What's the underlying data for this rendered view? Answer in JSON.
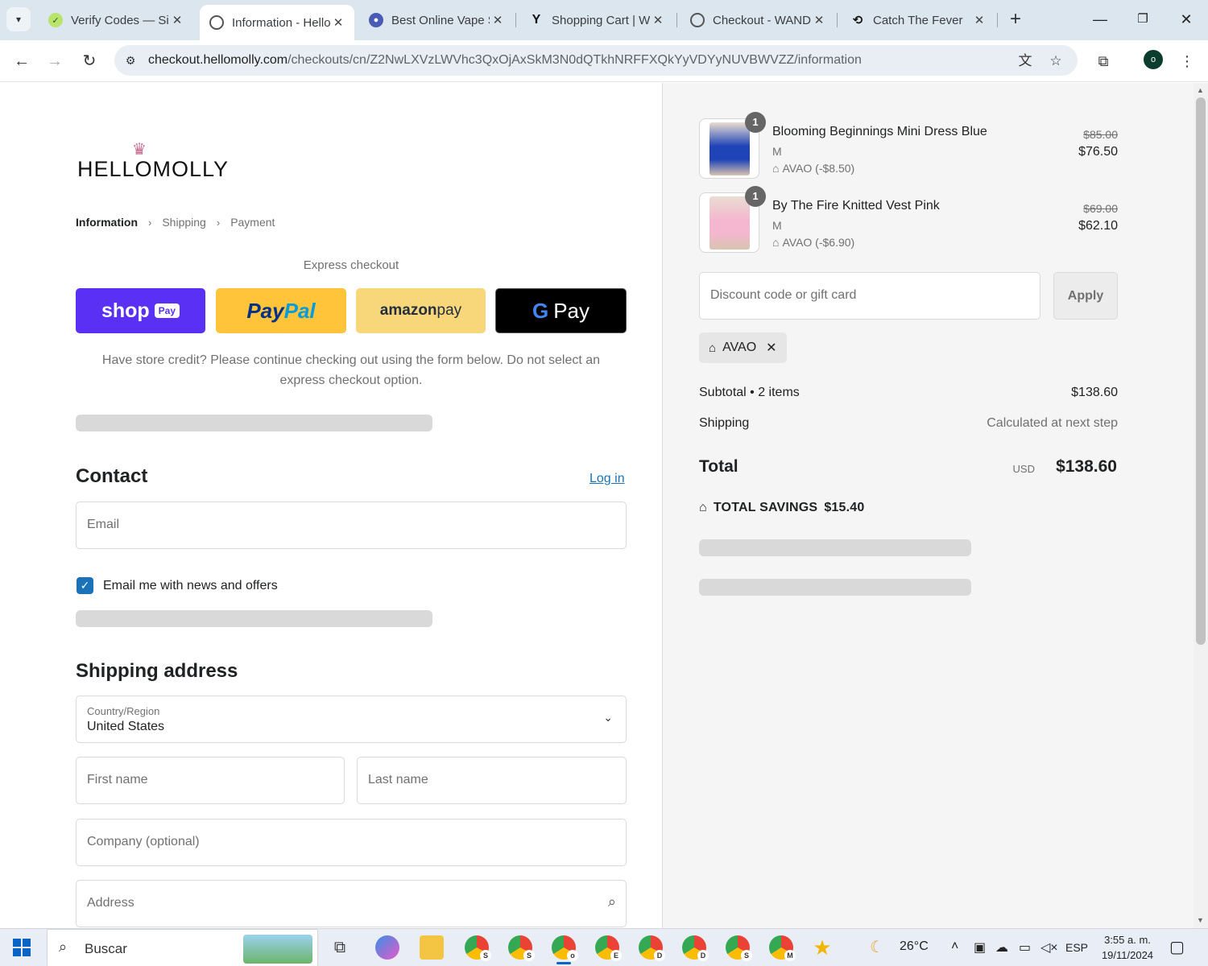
{
  "browser": {
    "tabs": [
      {
        "title": "Verify Codes — SimplyCodes",
        "icon": "simplycodes-icon",
        "active": false
      },
      {
        "title": "Information - Hello Molly",
        "icon": "globe-icon",
        "active": true
      },
      {
        "title": "Best Online Vape Shop",
        "icon": "vape-shop-icon",
        "active": false
      },
      {
        "title": "Shopping Cart | Wandering",
        "icon": "y-logo-icon",
        "active": false
      },
      {
        "title": "Checkout - WANDERING",
        "icon": "globe-icon",
        "active": false
      },
      {
        "title": "Catch The Fever",
        "icon": "fever-icon",
        "active": false
      }
    ],
    "url_host": "checkout.hellomolly.com",
    "url_path": "/checkouts/cn/Z2NwLXVzLWVhc3QxOjAxSkM3N0dQTkhNRFFXQkYyVDYyNUVBWVZZ/information",
    "profile_initial": "o"
  },
  "checkout": {
    "logo_text": "HELLOMOLLY",
    "breadcrumbs": [
      "Information",
      "Shipping",
      "Payment"
    ],
    "express_title": "Express checkout",
    "express_buttons": {
      "shop": "shop",
      "shop_pill": "Pay",
      "paypal_a": "Pay",
      "paypal_b": "Pal",
      "amazon_a": "amazon",
      "amazon_b": " pay",
      "gpay_g": "G",
      "gpay": "Pay"
    },
    "credit_note": "Have store credit? Please continue checking out using the form below. Do not select an express checkout option.",
    "contact": {
      "heading": "Contact",
      "login": "Log in",
      "email_placeholder": "Email",
      "newsletter_label": "Email me with news and offers",
      "newsletter_checked": true
    },
    "shipping": {
      "heading": "Shipping address",
      "country_label": "Country/Region",
      "country_value": "United States",
      "first_name": "First name",
      "last_name": "Last name",
      "company": "Company (optional)",
      "address": "Address"
    }
  },
  "summary": {
    "items": [
      {
        "name": "Blooming Beginnings Mini Dress Blue",
        "variant": "M",
        "discount": "AVAO (-$8.50)",
        "price_old": "$85.00",
        "price_new": "$76.50",
        "qty": "1",
        "color": "#1f44b8"
      },
      {
        "name": "By The Fire Knitted Vest Pink",
        "variant": "M",
        "discount": "AVAO (-$6.90)",
        "price_old": "$69.00",
        "price_new": "$62.10",
        "qty": "1",
        "color": "#f4b7cf"
      }
    ],
    "discount_placeholder": "Discount code or gift card",
    "apply_label": "Apply",
    "applied_code": "AVAO",
    "subtotal_label": "Subtotal • 2 items",
    "subtotal_value": "$138.60",
    "shipping_label": "Shipping",
    "shipping_value": "Calculated at next step",
    "total_label": "Total",
    "total_currency": "USD",
    "total_value": "$138.60",
    "savings_label": "TOTAL SAVINGS",
    "savings_value": "$15.40"
  },
  "taskbar": {
    "search_placeholder": "Buscar",
    "weather": "26°C",
    "language": "ESP",
    "time": "3:55 a. m.",
    "date": "19/11/2024"
  }
}
